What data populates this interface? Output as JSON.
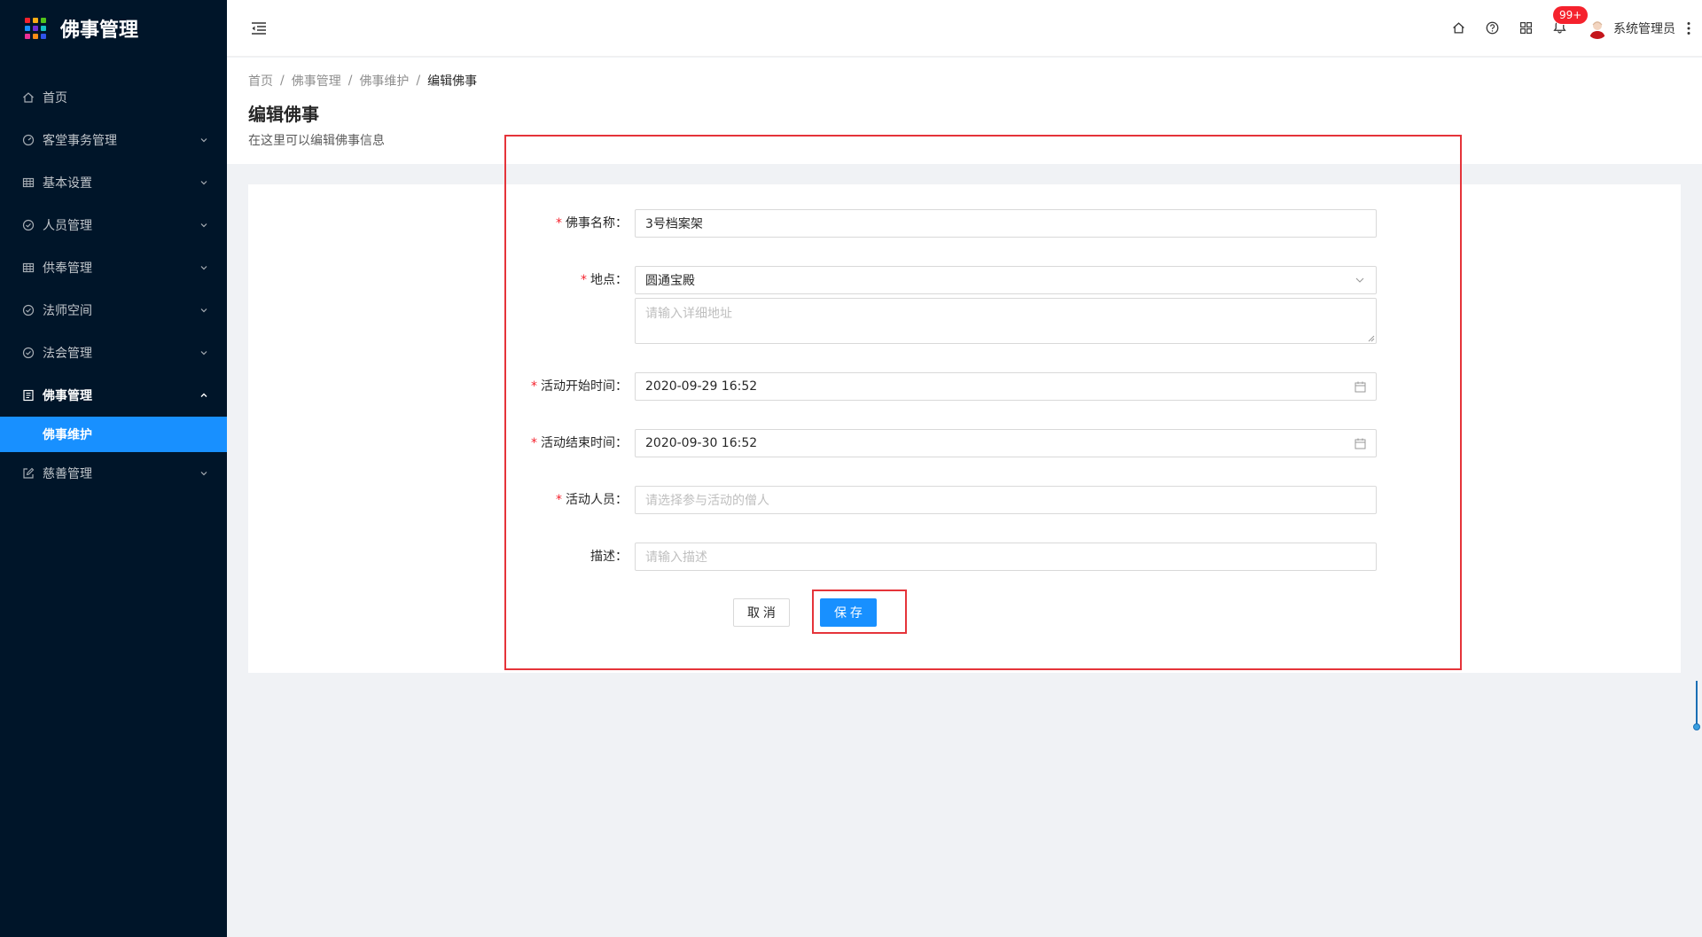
{
  "app": {
    "title": "佛事管理",
    "logo_icon": "grid-dots-icon",
    "logo_colors": [
      "#f5222d",
      "#faad14",
      "#52c41a",
      "#1890ff",
      "#722ed1",
      "#13c2c2",
      "#eb2f96",
      "#fa8c16",
      "#2f54eb"
    ]
  },
  "sidebar": {
    "items": [
      {
        "label": "首页",
        "icon": "home-icon",
        "has_arrow": false
      },
      {
        "label": "客堂事务管理",
        "icon": "dashboard-icon",
        "has_arrow": true
      },
      {
        "label": "基本设置",
        "icon": "table-icon",
        "has_arrow": true
      },
      {
        "label": "人员管理",
        "icon": "check-circle-icon",
        "has_arrow": true
      },
      {
        "label": "供奉管理",
        "icon": "table-icon",
        "has_arrow": true
      },
      {
        "label": "法师空间",
        "icon": "check-circle-icon",
        "has_arrow": true
      },
      {
        "label": "法会管理",
        "icon": "check-circle-icon",
        "has_arrow": true
      },
      {
        "label": "佛事管理",
        "icon": "profile-icon",
        "has_arrow": true,
        "open": true
      },
      {
        "label": "慈善管理",
        "icon": "form-edit-icon",
        "has_arrow": true
      }
    ],
    "active_sub": "佛事维护",
    "active_color": "#1890ff",
    "bg_color": "#001529"
  },
  "header": {
    "fold_icon": "menu-fold-icon",
    "icons": [
      "home-icon",
      "question-circle-icon",
      "appstore-icon"
    ],
    "notification_icon": "bell-icon",
    "notification_badge": "99+",
    "user_name": "系统管理员",
    "more_icon": "more-vertical-icon"
  },
  "breadcrumb": {
    "items": [
      "首页",
      "佛事管理",
      "佛事维护"
    ],
    "current": "编辑佛事",
    "separator": "/"
  },
  "page": {
    "title": "编辑佛事",
    "description": "在这里可以编辑佛事信息"
  },
  "form": {
    "name": {
      "label": "佛事名称",
      "required": true,
      "value": "3号档案架"
    },
    "location": {
      "label": "地点",
      "required": true,
      "value": "圆通宝殿",
      "detail_placeholder": "请输入详细地址"
    },
    "start_time": {
      "label": "活动开始时间",
      "required": true,
      "value": "2020-09-29 16:52"
    },
    "end_time": {
      "label": "活动结束时间",
      "required": true,
      "value": "2020-09-30 16:52"
    },
    "people": {
      "label": "活动人员",
      "required": true,
      "placeholder": "请选择参与活动的僧人"
    },
    "description": {
      "label": "描述",
      "required": false,
      "placeholder": "请输入描述"
    },
    "label_colon": "：",
    "required_mark": "*",
    "cancel_label": "取 消",
    "save_label": "保 存"
  },
  "colors": {
    "primary": "#1890ff",
    "required": "#f5222d",
    "annotation": "#e5343a"
  }
}
